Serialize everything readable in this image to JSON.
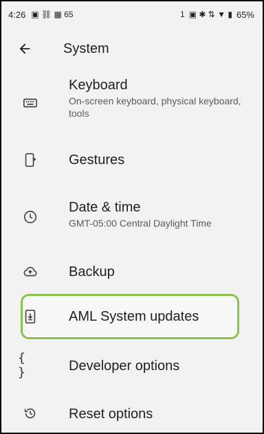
{
  "status_bar": {
    "time": "4:26",
    "left_icons": "▣ ⛓ ▦ 65",
    "sim": "1",
    "right_icons": "▣ ✱ ⇅ ▼ ▮",
    "battery": "65%"
  },
  "app_bar": {
    "title": "System",
    "back_icon": "arrow-back-icon"
  },
  "items": [
    {
      "title": "Keyboard",
      "summary": "On-screen keyboard, physical keyboard, tools",
      "icon": "keyboard-icon"
    },
    {
      "title": "Gestures",
      "summary": "",
      "icon": "gestures-icon"
    },
    {
      "title": "Date & time",
      "summary": "GMT-05:00 Central Daylight Time",
      "icon": "clock-icon"
    },
    {
      "title": "Backup",
      "summary": "",
      "icon": "cloud-upload-icon"
    },
    {
      "title": "AML System updates",
      "summary": "",
      "icon": "system-update-icon"
    },
    {
      "title": "Developer options",
      "summary": "",
      "icon": "braces-icon"
    },
    {
      "title": "Reset options",
      "summary": "",
      "icon": "history-icon"
    }
  ],
  "highlight_color": "#8bc34a"
}
